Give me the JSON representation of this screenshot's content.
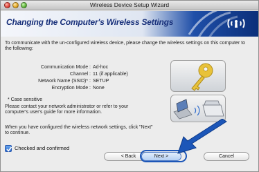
{
  "window": {
    "title": "Wireless Device Setup Wizard"
  },
  "header": {
    "title": "Changing the Computer's Wireless Settings",
    "icon": "wireless-signal-icon",
    "accent_color": "#0b2f7a"
  },
  "intro": "To communicate with the un-configured wireless device, please change the wireless settings on this computer to the following:",
  "settings": [
    {
      "label": "Communication Mode :",
      "value": "Ad-hoc"
    },
    {
      "label": "Channel :",
      "value": "11  (if applicable)"
    },
    {
      "label": "Network Name (SSID)* :",
      "value": "SETUP"
    },
    {
      "label": "Encryption Mode :",
      "value": "None"
    }
  ],
  "note": "* Case sensitive",
  "contact": "Please contact your network administrator or refer to your computer's user's guide for more information.",
  "when_configured": "When you have configured the wireless network settings, click \"Next\" to continue.",
  "checkbox": {
    "label": "Checked and confirmed",
    "checked": true
  },
  "buttons": {
    "back": "< Back",
    "next": "Next >",
    "cancel": "Cancel"
  }
}
